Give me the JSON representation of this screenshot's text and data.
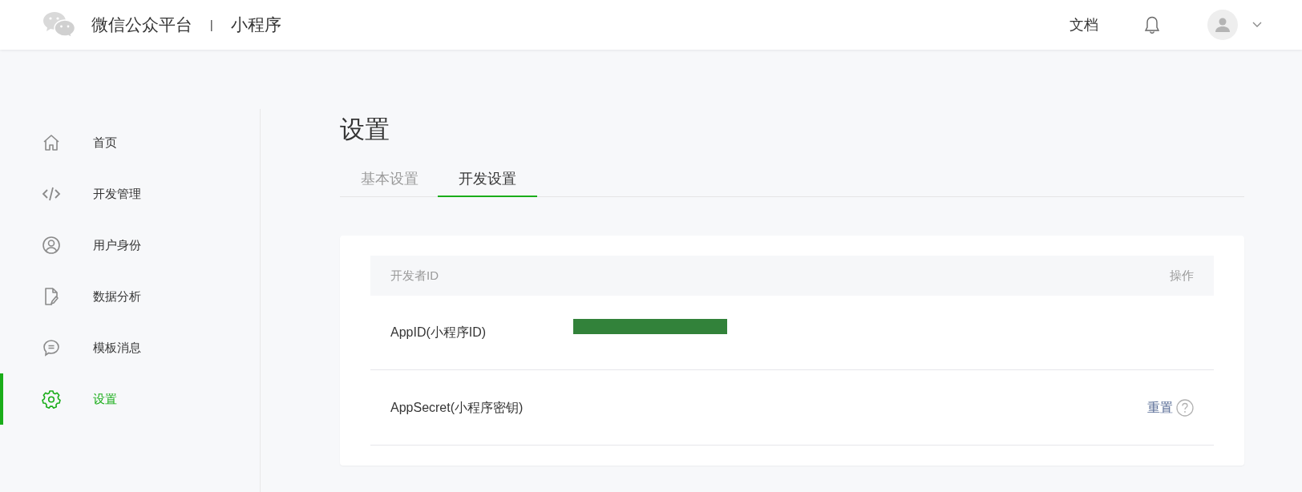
{
  "header": {
    "brand": "微信公众平台",
    "separator": "|",
    "product": "小程序",
    "links": [
      "文档"
    ]
  },
  "sidebar": {
    "items": [
      {
        "label": "首页",
        "selected": false
      },
      {
        "label": "开发管理",
        "selected": false
      },
      {
        "label": "用户身份",
        "selected": false
      },
      {
        "label": "数据分析",
        "selected": false
      },
      {
        "label": "模板消息",
        "selected": false
      },
      {
        "label": "设置",
        "selected": true
      }
    ]
  },
  "page_title": "设置",
  "tabs": [
    {
      "label": "基本设置",
      "selected": false
    },
    {
      "label": "开发设置",
      "selected": true
    }
  ],
  "table": {
    "columns": [
      "开发者ID",
      "操作"
    ],
    "rows": [
      {
        "label": "AppID(小程序ID)",
        "value_redacted": true
      },
      {
        "label": "AppSecret(小程序密钥)",
        "action": "重置",
        "help": true
      }
    ]
  }
}
